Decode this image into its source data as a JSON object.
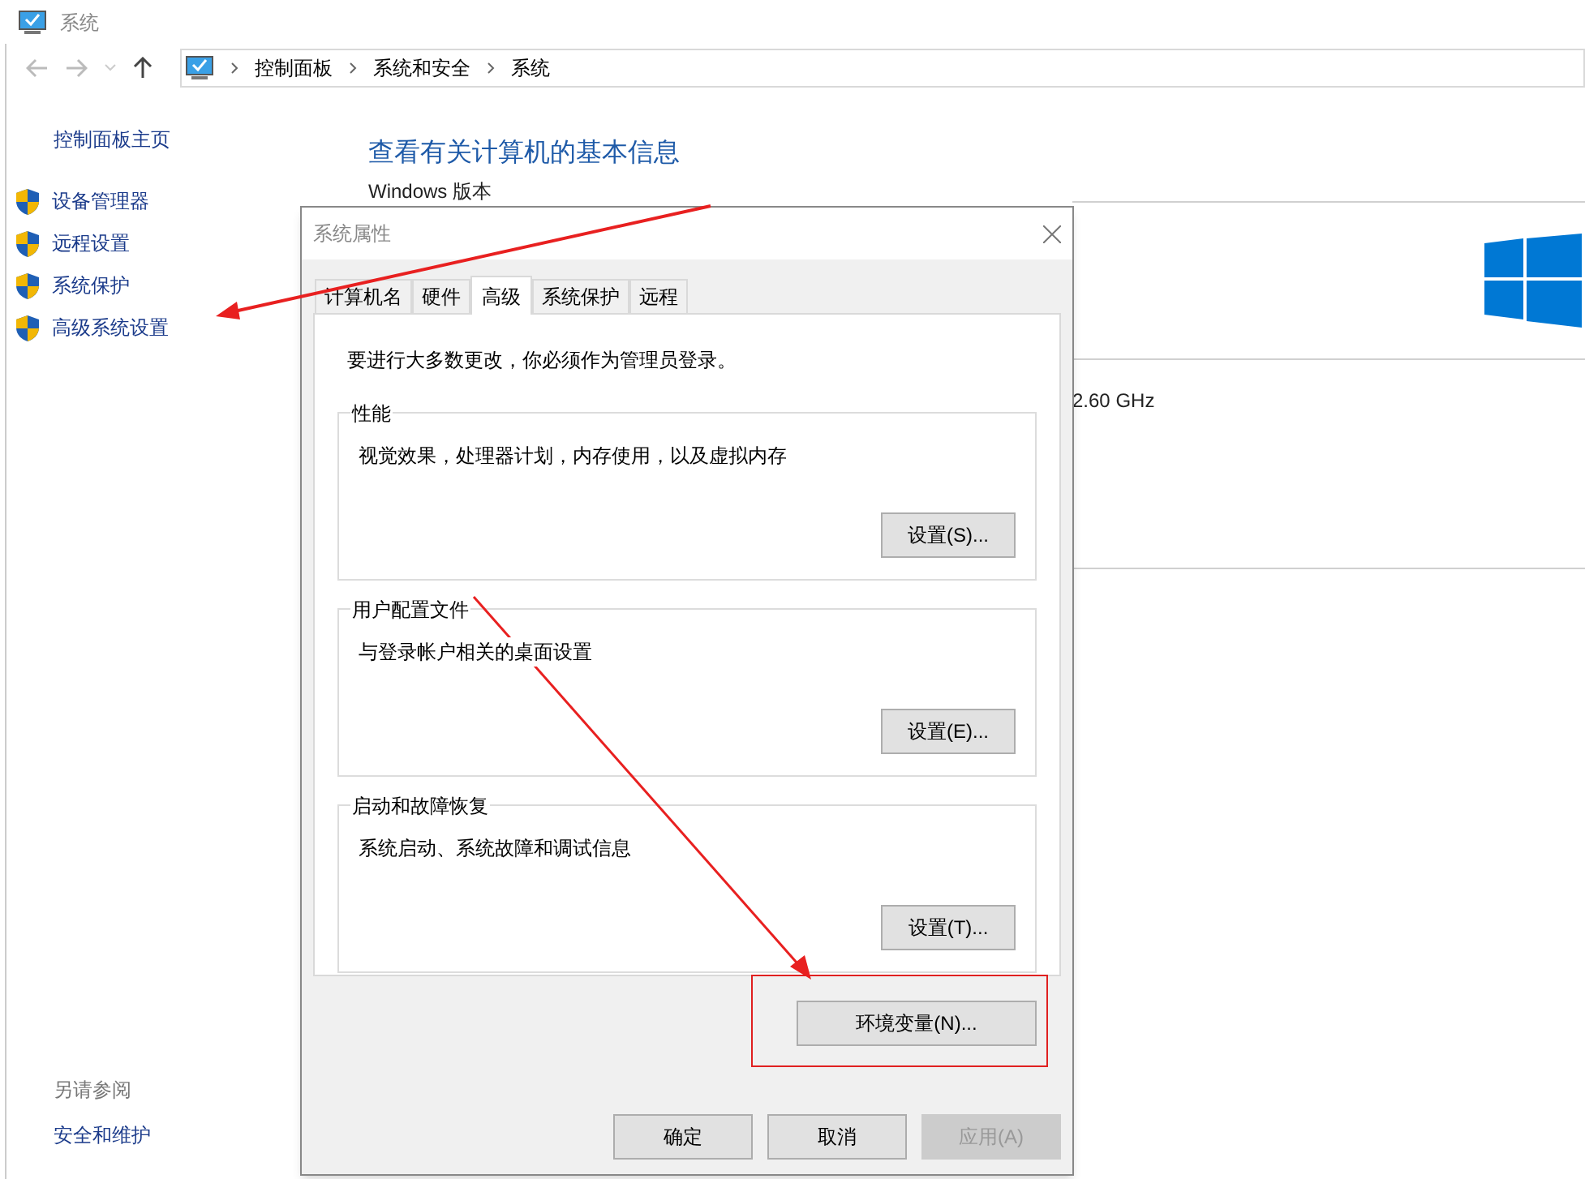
{
  "window": {
    "title": "系统"
  },
  "breadcrumb": [
    "控制面板",
    "系统和安全",
    "系统"
  ],
  "sidebar": {
    "home": "控制面板主页",
    "items": [
      "设备管理器",
      "远程设置",
      "系统保护",
      "高级系统设置"
    ],
    "see_also": {
      "heading": "另请参阅",
      "links": [
        "安全和维护"
      ]
    }
  },
  "main": {
    "heading": "查看有关计算机的基本信息",
    "section": "Windows 版本",
    "processor_speed": "2.60 GHz"
  },
  "dialog": {
    "title": "系统属性",
    "tabs": [
      {
        "label": "计算机名",
        "selected": false
      },
      {
        "label": "硬件",
        "selected": false
      },
      {
        "label": "高级",
        "selected": true
      },
      {
        "label": "系统保护",
        "selected": false
      },
      {
        "label": "远程",
        "selected": false
      }
    ],
    "note": "要进行大多数更改，你必须作为管理员登录。",
    "groups": [
      {
        "title": "性能",
        "description": "视觉效果，处理器计划，内存使用，以及虚拟内存",
        "button": "设置(S)..."
      },
      {
        "title": "用户配置文件",
        "description": "与登录帐户相关的桌面设置",
        "button": "设置(E)..."
      },
      {
        "title": "启动和故障恢复",
        "description": "系统启动、系统故障和调试信息",
        "button": "设置(T)..."
      }
    ],
    "env_button": "环境变量(N)...",
    "footer_buttons": [
      {
        "label": "确定",
        "disabled": false
      },
      {
        "label": "取消",
        "disabled": false
      },
      {
        "label": "应用(A)",
        "disabled": true
      }
    ]
  }
}
